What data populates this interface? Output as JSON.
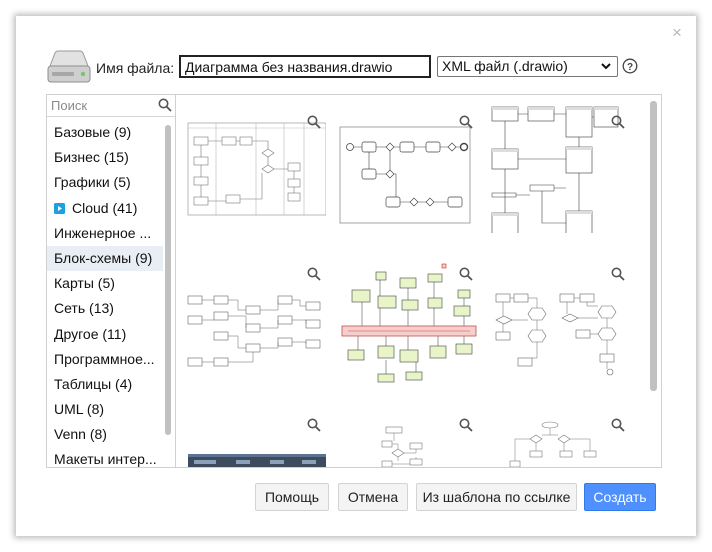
{
  "dialog": {
    "close_symbol": "×",
    "filename_label": "Имя файла:",
    "filename_value": "Диаграмма без названия.drawio",
    "format_selected": "XML файл (.drawio)",
    "help_symbol": "?"
  },
  "sidebar": {
    "search_placeholder": "Поиск",
    "categories": [
      {
        "label": "Базовые (9)"
      },
      {
        "label": "Бизнес (15)"
      },
      {
        "label": "Графики (5)"
      },
      {
        "label": "Cloud (41)"
      },
      {
        "label": "Инженерное ..."
      },
      {
        "label": "Блок-схемы (9)"
      },
      {
        "label": "Карты (5)"
      },
      {
        "label": "Сеть (13)"
      },
      {
        "label": "Другое (11)"
      },
      {
        "label": "Программное..."
      },
      {
        "label": "Таблицы (4)"
      },
      {
        "label": "UML (8)"
      },
      {
        "label": "Venn (8)"
      },
      {
        "label": "Макеты интер..."
      }
    ],
    "selected_index": 5
  },
  "buttons": {
    "help": "Помощь",
    "cancel": "Отмена",
    "from_url": "Из шаблона по ссылке",
    "create": "Создать"
  },
  "colors": {
    "primary": "#4d90fe",
    "selected_bg": "#e9eef4",
    "cloud_icon": "#1ba1e2",
    "mindmap_green": "#e8f5c8",
    "mindmap_red": "#f8cecc"
  },
  "icons": {
    "drive": "hard-drive-icon",
    "help": "help-circle-icon",
    "search": "search-icon",
    "zoom": "zoom-icon",
    "cloud": "cloud-play-icon"
  }
}
